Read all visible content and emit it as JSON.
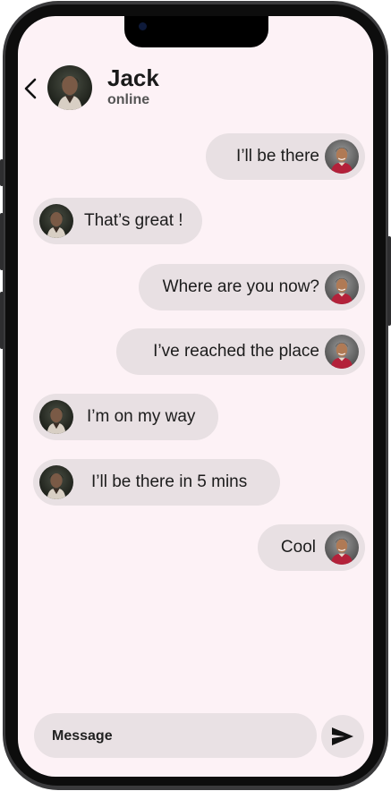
{
  "contact": {
    "name": "Jack",
    "status": "online"
  },
  "messages": [
    {
      "side": "out",
      "text": "I’ll be there"
    },
    {
      "side": "in",
      "text": "That’s great !"
    },
    {
      "side": "out",
      "text": "Where are you now?"
    },
    {
      "side": "out",
      "text": "I’ve reached the place"
    },
    {
      "side": "in",
      "text": "I’m on my way"
    },
    {
      "side": "in",
      "text": "I’ll be there in 5 mins"
    },
    {
      "side": "out",
      "text": "Cool"
    }
  ],
  "composer": {
    "placeholder": "Message"
  },
  "icons": {
    "back": "chevron-left-icon",
    "send": "send-icon"
  },
  "colors": {
    "background": "#fdf2f6",
    "bubble": "#e8e0e3",
    "text": "#1c1c1c",
    "status": "#555555",
    "self_avatar_shirt": "#b3213a"
  }
}
